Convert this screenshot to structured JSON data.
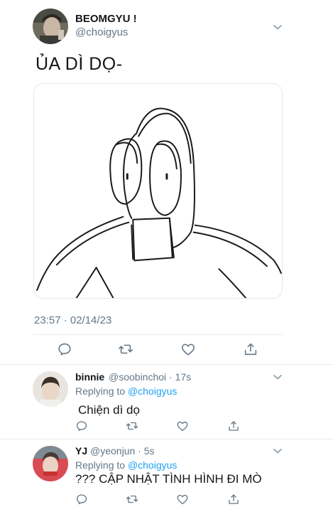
{
  "main_tweet": {
    "display_name": "BEOMGYU !",
    "handle": "@choigyus",
    "text": "ỦA DÌ DỌ-",
    "timestamp": "23:57 · 02/14/23"
  },
  "replies": [
    {
      "display_name": "binnie",
      "handle": "@soobinchoi · 17s",
      "replying_prefix": "Replying to",
      "replying_to": "@choigyus",
      "text": "Chiện dì dọ"
    },
    {
      "display_name": "YJ",
      "handle": "@yeonjun · 5s",
      "replying_prefix": "Replying to",
      "replying_to": "@choigyus",
      "text": "??? CẬP NHẬT TÌNH HÌNH ĐI MÒ"
    }
  ],
  "colors": {
    "text": "#14171a",
    "secondary": "#657786",
    "link": "#1da1f2",
    "divider": "#e6ecf0"
  }
}
